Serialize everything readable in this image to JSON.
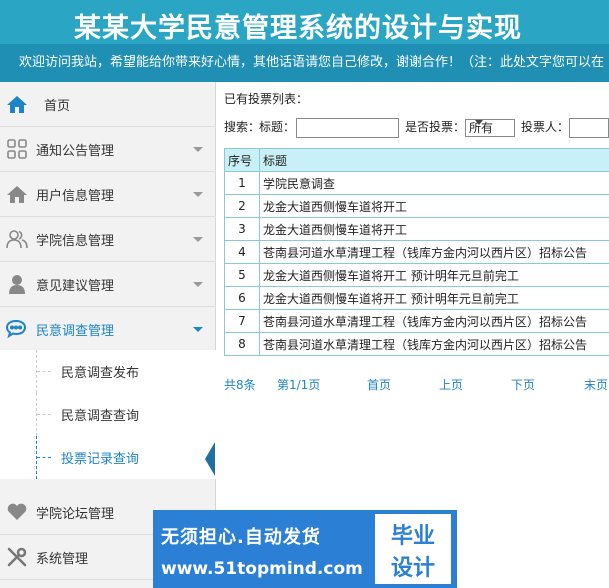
{
  "header": {
    "title": "某某大学民意管理系统的设计与实现",
    "marquee": "欢迎访问我站，希望能给你带来好心情，其他话语请您自己修改，谢谢合作！（注：此处文字您可以在"
  },
  "sidebar": {
    "items": [
      {
        "label": "首页",
        "icon": "home-icon"
      },
      {
        "label": "通知公告管理",
        "icon": "grid-icon"
      },
      {
        "label": "用户信息管理",
        "icon": "home-icon"
      },
      {
        "label": "学院信息管理",
        "icon": "users-icon"
      },
      {
        "label": "意见建议管理",
        "icon": "user-icon"
      },
      {
        "label": "民意调查管理",
        "icon": "chat-icon"
      },
      {
        "label": "学院论坛管理",
        "icon": "heart-icon"
      },
      {
        "label": "系统管理",
        "icon": "wrench-icon"
      }
    ],
    "subitems": [
      "民意调查发布",
      "民意调查查询",
      "投票记录查询"
    ]
  },
  "main": {
    "list_title": "已有投票列表：",
    "search": {
      "label": "搜索：",
      "title_label": "标题：",
      "voted_label": "是否投票：",
      "voted_value": "所有",
      "voter_label": "投票人："
    },
    "table": {
      "headers": [
        "序号",
        "标题"
      ],
      "rows": [
        [
          "1",
          "学院民意调查"
        ],
        [
          "2",
          "龙金大道西侧慢车道将开工"
        ],
        [
          "3",
          "龙金大道西侧慢车道将开工"
        ],
        [
          "4",
          "苍南县河道水草清理工程（钱库方金内河以西片区）招标公告"
        ],
        [
          "5",
          "龙金大道西侧慢车道将开工  预计明年元旦前完工"
        ],
        [
          "6",
          "龙金大道西侧慢车道将开工  预计明年元旦前完工"
        ],
        [
          "7",
          "苍南县河道水草清理工程（钱库方金内河以西片区）招标公告"
        ],
        [
          "8",
          "苍南县河道水草清理工程（钱库方金内河以西片区）招标公告"
        ]
      ]
    },
    "pager": {
      "total": "共8条",
      "page": "第1/1页",
      "first": "首页",
      "prev": "上页",
      "next": "下页",
      "last": "末页"
    }
  },
  "ad": {
    "line1": "无须担心.自动发货",
    "line2": "www.51topmind.com",
    "badge1": "毕业",
    "badge2": "设计"
  },
  "colors": {
    "header": "#2aa6c4",
    "marquee": "#1f8fb4",
    "accent": "#1d84c6",
    "ad": "#2b7fd4"
  }
}
